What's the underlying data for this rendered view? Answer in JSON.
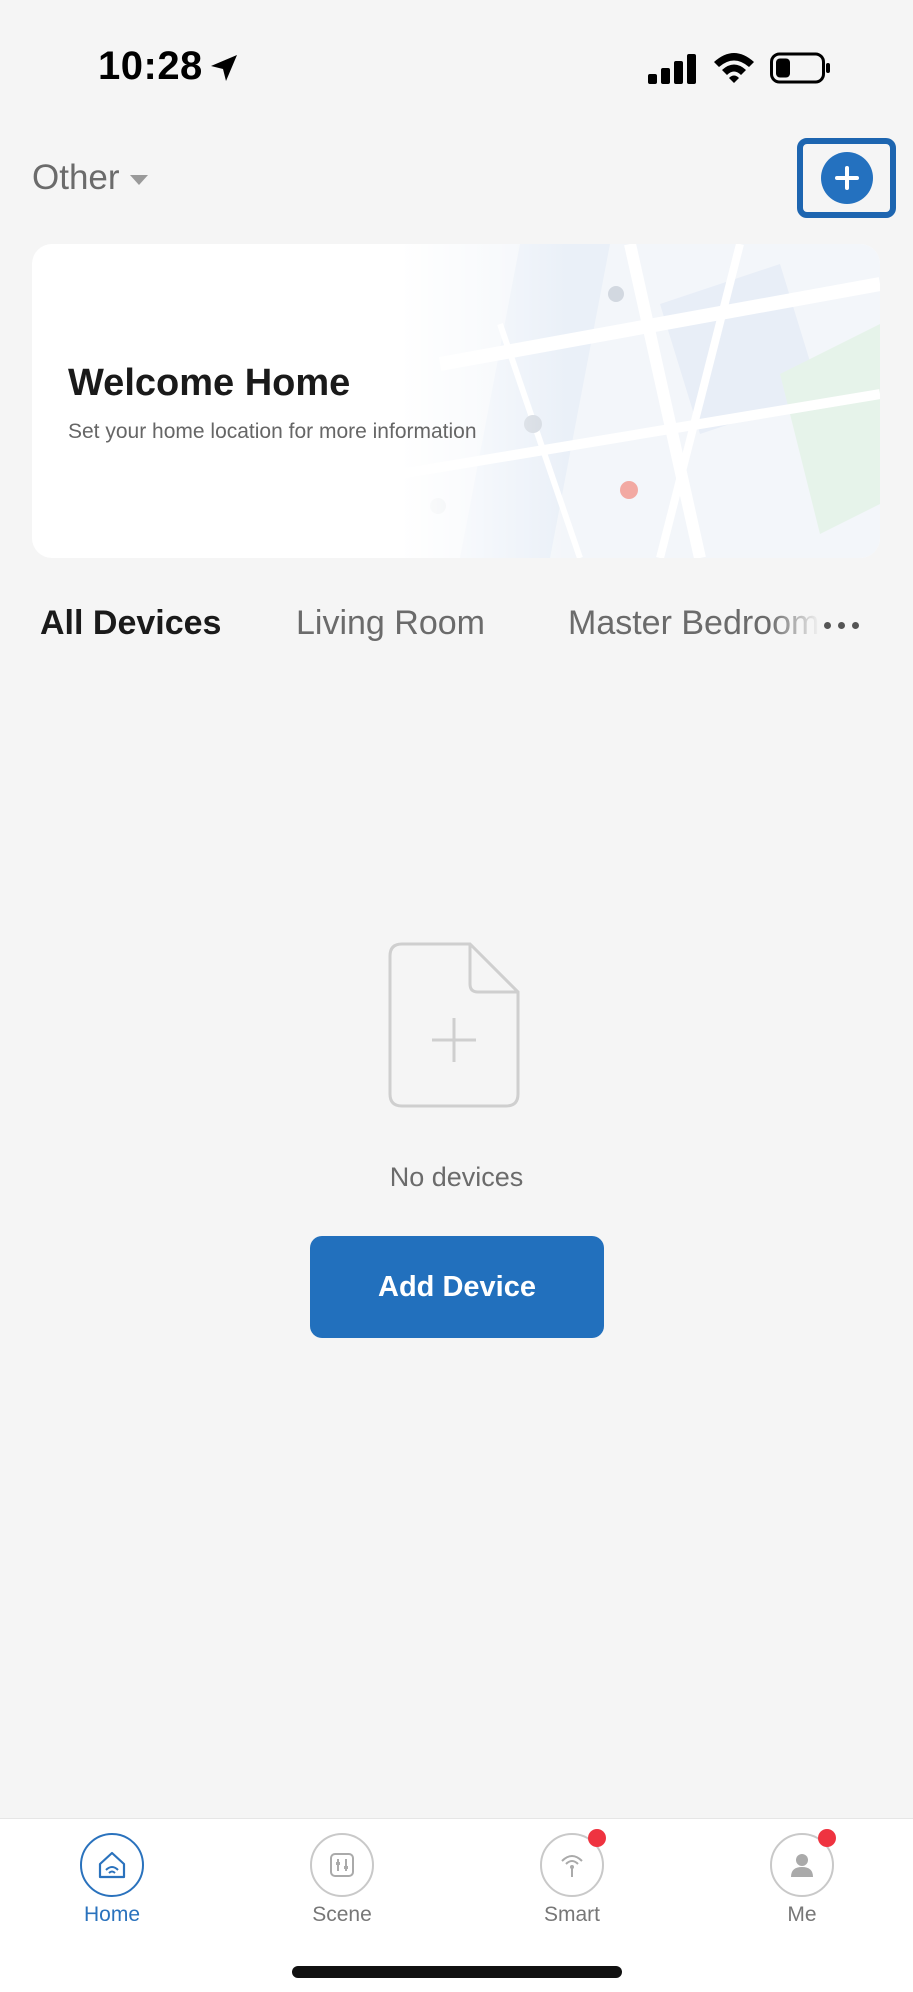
{
  "status_bar": {
    "time": "10:28",
    "icons": [
      "location-arrow-icon",
      "signal-icon",
      "wifi-icon",
      "battery-icon"
    ]
  },
  "header": {
    "home_name": "Other",
    "add_button_icon": "plus-circle-icon"
  },
  "welcome_card": {
    "title": "Welcome Home",
    "subtitle": "Set your home location for more information"
  },
  "room_tabs": {
    "items": [
      {
        "label": "All Devices",
        "active": true
      },
      {
        "label": "Living Room",
        "active": false
      },
      {
        "label": "Master Bedroom",
        "active": false
      }
    ],
    "more_icon": "more-horizontal-icon"
  },
  "empty_state": {
    "icon": "add-file-icon",
    "message": "No devices",
    "button_label": "Add Device"
  },
  "bottom_nav": {
    "items": [
      {
        "label": "Home",
        "icon": "home-icon",
        "active": true,
        "badge": false
      },
      {
        "label": "Scene",
        "icon": "scene-icon",
        "active": false,
        "badge": false
      },
      {
        "label": "Smart",
        "icon": "smart-antenna-icon",
        "active": false,
        "badge": true
      },
      {
        "label": "Me",
        "icon": "user-icon",
        "active": false,
        "badge": true
      }
    ]
  },
  "colors": {
    "accent": "#2270bd",
    "highlight_border": "#1d65b0",
    "badge": "#ef3340",
    "background": "#f5f5f5"
  }
}
